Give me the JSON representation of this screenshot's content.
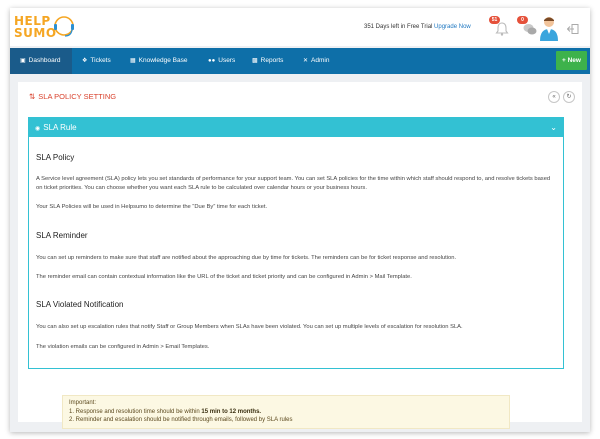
{
  "brand": {
    "line1": "HELP",
    "line2": "SUMO",
    "accent": "#f5a623"
  },
  "header": {
    "trial_text": "351 Days left in Free Trial",
    "upgrade_label": "Upgrade Now",
    "notif_count": "51",
    "chat_count": "0"
  },
  "nav": {
    "items": [
      {
        "label": "Dashboard",
        "icon": "dashboard-icon"
      },
      {
        "label": "Tickets",
        "icon": "ticket-icon"
      },
      {
        "label": "Knowledge Base",
        "icon": "book-icon"
      },
      {
        "label": "Users",
        "icon": "users-icon"
      },
      {
        "label": "Reports",
        "icon": "chart-icon"
      },
      {
        "label": "Admin",
        "icon": "wrench-icon"
      }
    ],
    "new_label": "+ New"
  },
  "page": {
    "title": "SLA POLICY SETTING",
    "section_title": "SLA Rule",
    "sections": [
      {
        "heading": "SLA Policy",
        "paragraphs": [
          "A Service level agreement (SLA) policy lets you set standards of performance for your support team. You can set SLA policies for the time within which staff should respond to, and resolve tickets based on ticket priorities. You can choose whether you want each SLA rule to be calculated over calendar hours or your business hours.",
          "Your SLA Policies will be used in Helpsumo to determine the “Due By” time for each ticket."
        ]
      },
      {
        "heading": "SLA Reminder",
        "paragraphs": [
          "You can set up reminders to make sure that staff are notified about the approaching due by time for tickets. The reminders can be for ticket response and resolution.",
          "The reminder email can contain contextual information like the URL of the ticket and ticket priority and can be configured in Admin > Mail Template."
        ]
      },
      {
        "heading": "SLA Violated Notification",
        "paragraphs": [
          "You can also set up escalation rules that notify Staff or Group Members when SLAs have been violated. You can set up multiple levels of escalation for resolution SLA.",
          "The violation emails can be configured in Admin > Email Templates."
        ]
      }
    ],
    "important": {
      "title": "Important:",
      "line1_prefix": "1. Response and resolution time should be within ",
      "line1_bold": "15 min to 12 months.",
      "line2": "2. Reminder and escalation should be notified through emails, followed by SLA rules"
    }
  },
  "colors": {
    "nav": "#0e6fa8",
    "accent_teal": "#33c1d3",
    "title_red": "#d9422d",
    "new_green": "#3db24b"
  }
}
